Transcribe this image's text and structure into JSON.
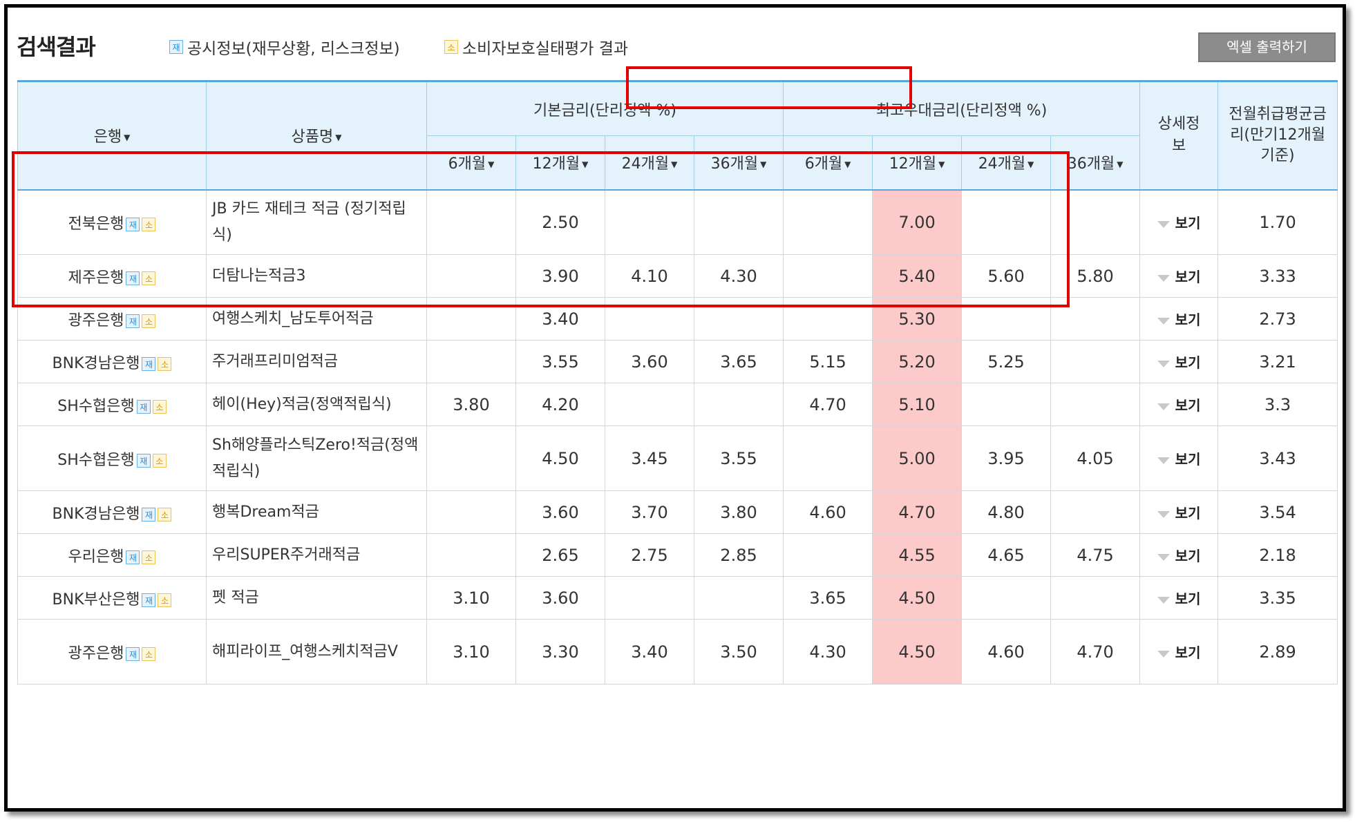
{
  "title": "검색결과",
  "legend": [
    {
      "badge": "재",
      "label": "공시정보(재무상황, 리스크정보)"
    },
    {
      "badge": "소",
      "label": "소비자보호실태평가 결과"
    }
  ],
  "excel_button": "엑셀 출력하기",
  "columns": {
    "bank": "은행",
    "product": "상품명",
    "base_rate": "기본금리(단리정액 %)",
    "max_rate": "최고우대금리(단리정액 %)",
    "detail": "상세정보",
    "avg": "전월취급평균금리(만기12개월기준)",
    "terms": [
      "6개월",
      "12개월",
      "24개월",
      "36개월"
    ]
  },
  "colors": {
    "highlight": "#fdcaca",
    "header_bg": "#e4f2fb",
    "accent_border": "#58a7dc",
    "red_box": "#e00000"
  },
  "view_label": "보기",
  "rows": [
    {
      "bank": "전북은행",
      "product": "JB 카드 재테크 적금 (정기적립식)",
      "b6": "",
      "b12": "2.50",
      "b24": "",
      "b36": "",
      "m6": "",
      "m12": "7.00",
      "m24": "",
      "m36": "",
      "avg": "1.70"
    },
    {
      "bank": "제주은행",
      "product": "더탐나는적금3",
      "b6": "",
      "b12": "3.90",
      "b24": "4.10",
      "b36": "4.30",
      "m6": "",
      "m12": "5.40",
      "m24": "5.60",
      "m36": "5.80",
      "avg": "3.33"
    },
    {
      "bank": "광주은행",
      "product": "여행스케치_남도투어적금",
      "b6": "",
      "b12": "3.40",
      "b24": "",
      "b36": "",
      "m6": "",
      "m12": "5.30",
      "m24": "",
      "m36": "",
      "avg": "2.73"
    },
    {
      "bank": "BNK경남은행",
      "product": "주거래프리미엄적금",
      "b6": "",
      "b12": "3.55",
      "b24": "3.60",
      "b36": "3.65",
      "m6": "5.15",
      "m12": "5.20",
      "m24": "5.25",
      "m36": "",
      "avg": "3.21"
    },
    {
      "bank": "SH수협은행",
      "product": "헤이(Hey)적금(정액적립식)",
      "b6": "3.80",
      "b12": "4.20",
      "b24": "",
      "b36": "",
      "m6": "4.70",
      "m12": "5.10",
      "m24": "",
      "m36": "",
      "avg": "3.3"
    },
    {
      "bank": "SH수협은행",
      "product": "Sh해양플라스틱Zero!적금(정액적립식)",
      "b6": "",
      "b12": "4.50",
      "b24": "3.45",
      "b36": "3.55",
      "m6": "",
      "m12": "5.00",
      "m24": "3.95",
      "m36": "4.05",
      "avg": "3.43"
    },
    {
      "bank": "BNK경남은행",
      "product": "행복Dream적금",
      "b6": "",
      "b12": "3.60",
      "b24": "3.70",
      "b36": "3.80",
      "m6": "4.60",
      "m12": "4.70",
      "m24": "4.80",
      "m36": "",
      "avg": "3.54"
    },
    {
      "bank": "우리은행",
      "product": "우리SUPER주거래적금",
      "b6": "",
      "b12": "2.65",
      "b24": "2.75",
      "b36": "2.85",
      "m6": "",
      "m12": "4.55",
      "m24": "4.65",
      "m36": "4.75",
      "avg": "2.18"
    },
    {
      "bank": "BNK부산은행",
      "product": "펫 적금",
      "b6": "3.10",
      "b12": "3.60",
      "b24": "",
      "b36": "",
      "m6": "3.65",
      "m12": "4.50",
      "m24": "",
      "m36": "",
      "avg": "3.35"
    },
    {
      "bank": "광주은행",
      "product": "해피라이프_여행스케치적금V",
      "b6": "3.10",
      "b12": "3.30",
      "b24": "3.40",
      "b36": "3.50",
      "m6": "4.30",
      "m12": "4.50",
      "m24": "4.60",
      "m36": "4.70",
      "avg": "2.89"
    }
  ]
}
